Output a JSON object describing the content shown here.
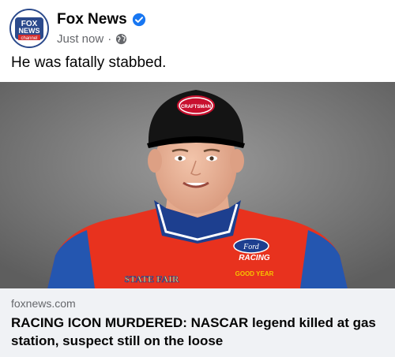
{
  "post": {
    "page_name": "Fox News",
    "timestamp": "Just now",
    "separator": "·",
    "audience_icon": "globe-icon",
    "verified_icon": "verified-badge-icon",
    "text": "He was fatally stabbed."
  },
  "avatar": {
    "logo_line1": "FOX",
    "logo_line2": "NEWS",
    "logo_line3": "channel"
  },
  "photo": {
    "cap_logo_text": "CRAFTSMAN",
    "suit_brand_ford": "Ford",
    "suit_brand_racing": "RACING",
    "suit_brand_goodyear": "GOOD YEAR",
    "suit_brand_statefair": "STATE FAIR"
  },
  "link_preview": {
    "domain": "foxnews.com",
    "headline": "RACING ICON MURDERED: NASCAR legend killed at gas station, suspect still on the loose"
  },
  "colors": {
    "verified_blue": "#1877f2",
    "fox_blue": "#2b4a8c",
    "fox_red": "#d32f2f",
    "link_bg": "#f0f2f5"
  }
}
